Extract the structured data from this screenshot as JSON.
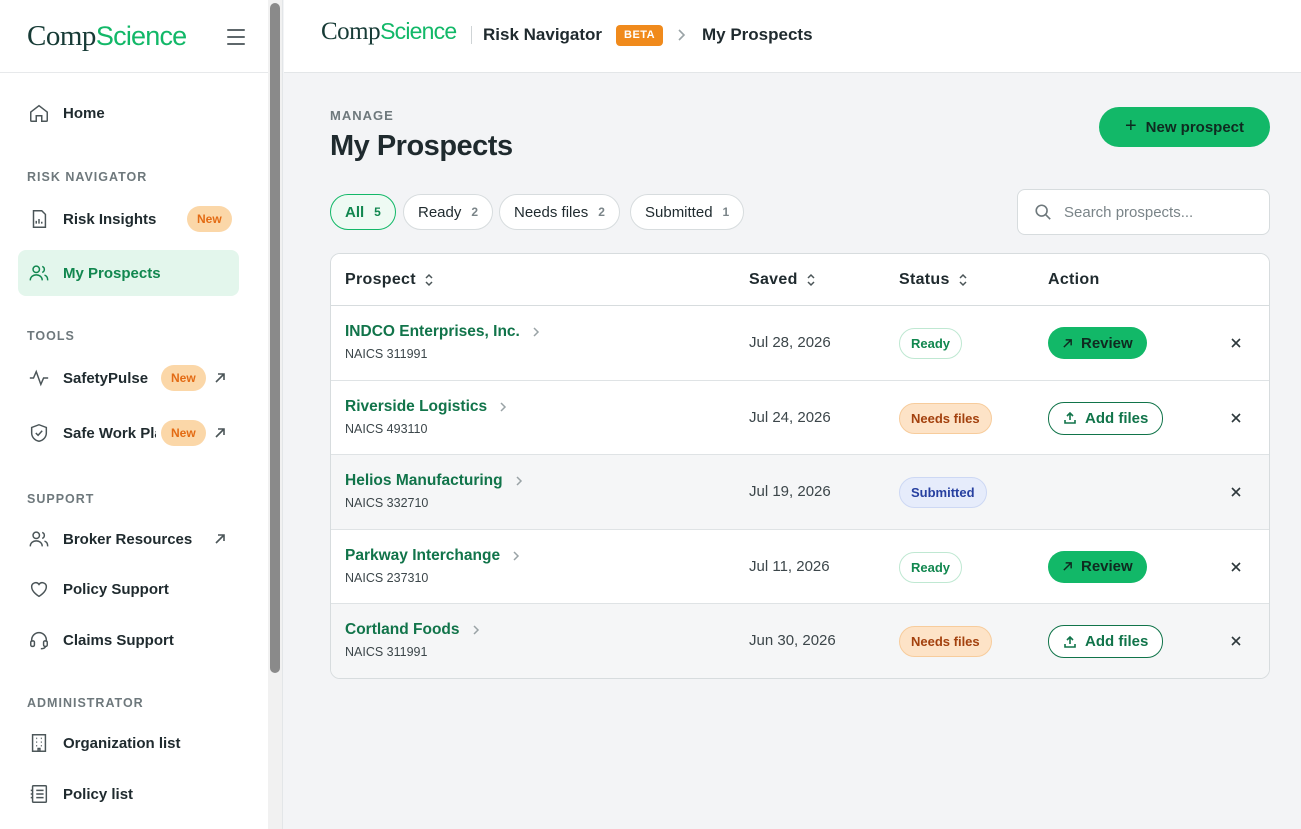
{
  "brand": {
    "part1": "Comp",
    "part2": "Science"
  },
  "sidebar": {
    "home": "Home",
    "sections": {
      "risk_navigator": "RISK NAVIGATOR",
      "tools": "TOOLS",
      "support": "SUPPORT",
      "administrator": "ADMINISTRATOR"
    },
    "items": {
      "risk_insights": {
        "label": "Risk Insights",
        "badge": "New"
      },
      "my_prospects": {
        "label": "My Prospects"
      },
      "safetypulse": {
        "label": "SafetyPulse",
        "badge": "New"
      },
      "safe_work": {
        "label": "Safe Work Pla",
        "badge": "New"
      },
      "broker_resources": {
        "label": "Broker Resources"
      },
      "policy_support": {
        "label": "Policy Support"
      },
      "claims_support": {
        "label": "Claims Support"
      },
      "organization_list": {
        "label": "Organization list"
      },
      "policy_list": {
        "label": "Policy list"
      }
    }
  },
  "topbar": {
    "app_name": "Risk Navigator",
    "beta": "BETA",
    "current": "My Prospects"
  },
  "main": {
    "eyebrow": "MANAGE",
    "title": "My Prospects",
    "new_button": "New prospect",
    "filters": [
      {
        "label": "All",
        "count": "5"
      },
      {
        "label": "Ready",
        "count": "2"
      },
      {
        "label": "Needs files",
        "count": "2"
      },
      {
        "label": "Submitted",
        "count": "1"
      }
    ],
    "search_placeholder": "Search prospects..."
  },
  "table": {
    "columns": [
      "Prospect",
      "Saved",
      "Status",
      "Action"
    ],
    "rows": [
      {
        "name": "INDCO Enterprises, Inc.",
        "naics": "NAICS 311991",
        "saved": "Jul 28, 2026",
        "status": "Ready",
        "action": "Review"
      },
      {
        "name": "Riverside Logistics",
        "naics": "NAICS 493110",
        "saved": "Jul 24, 2026",
        "status": "Needs files",
        "action": "Add files"
      },
      {
        "name": "Helios Manufacturing",
        "naics": "NAICS 332710",
        "saved": "Jul 19, 2026",
        "status": "Submitted",
        "action": ""
      },
      {
        "name": "Parkway Interchange",
        "naics": "NAICS 237310",
        "saved": "Jul 11, 2026",
        "status": "Ready",
        "action": "Review"
      },
      {
        "name": "Cortland Foods",
        "naics": "NAICS 311991",
        "saved": "Jun 30, 2026",
        "status": "Needs files",
        "action": "Add files"
      }
    ]
  },
  "colors": {
    "brand_green": "#12b868",
    "link_green": "#11744a",
    "active_bg": "#e3f6ec",
    "beta_orange": "#f08a1c"
  }
}
